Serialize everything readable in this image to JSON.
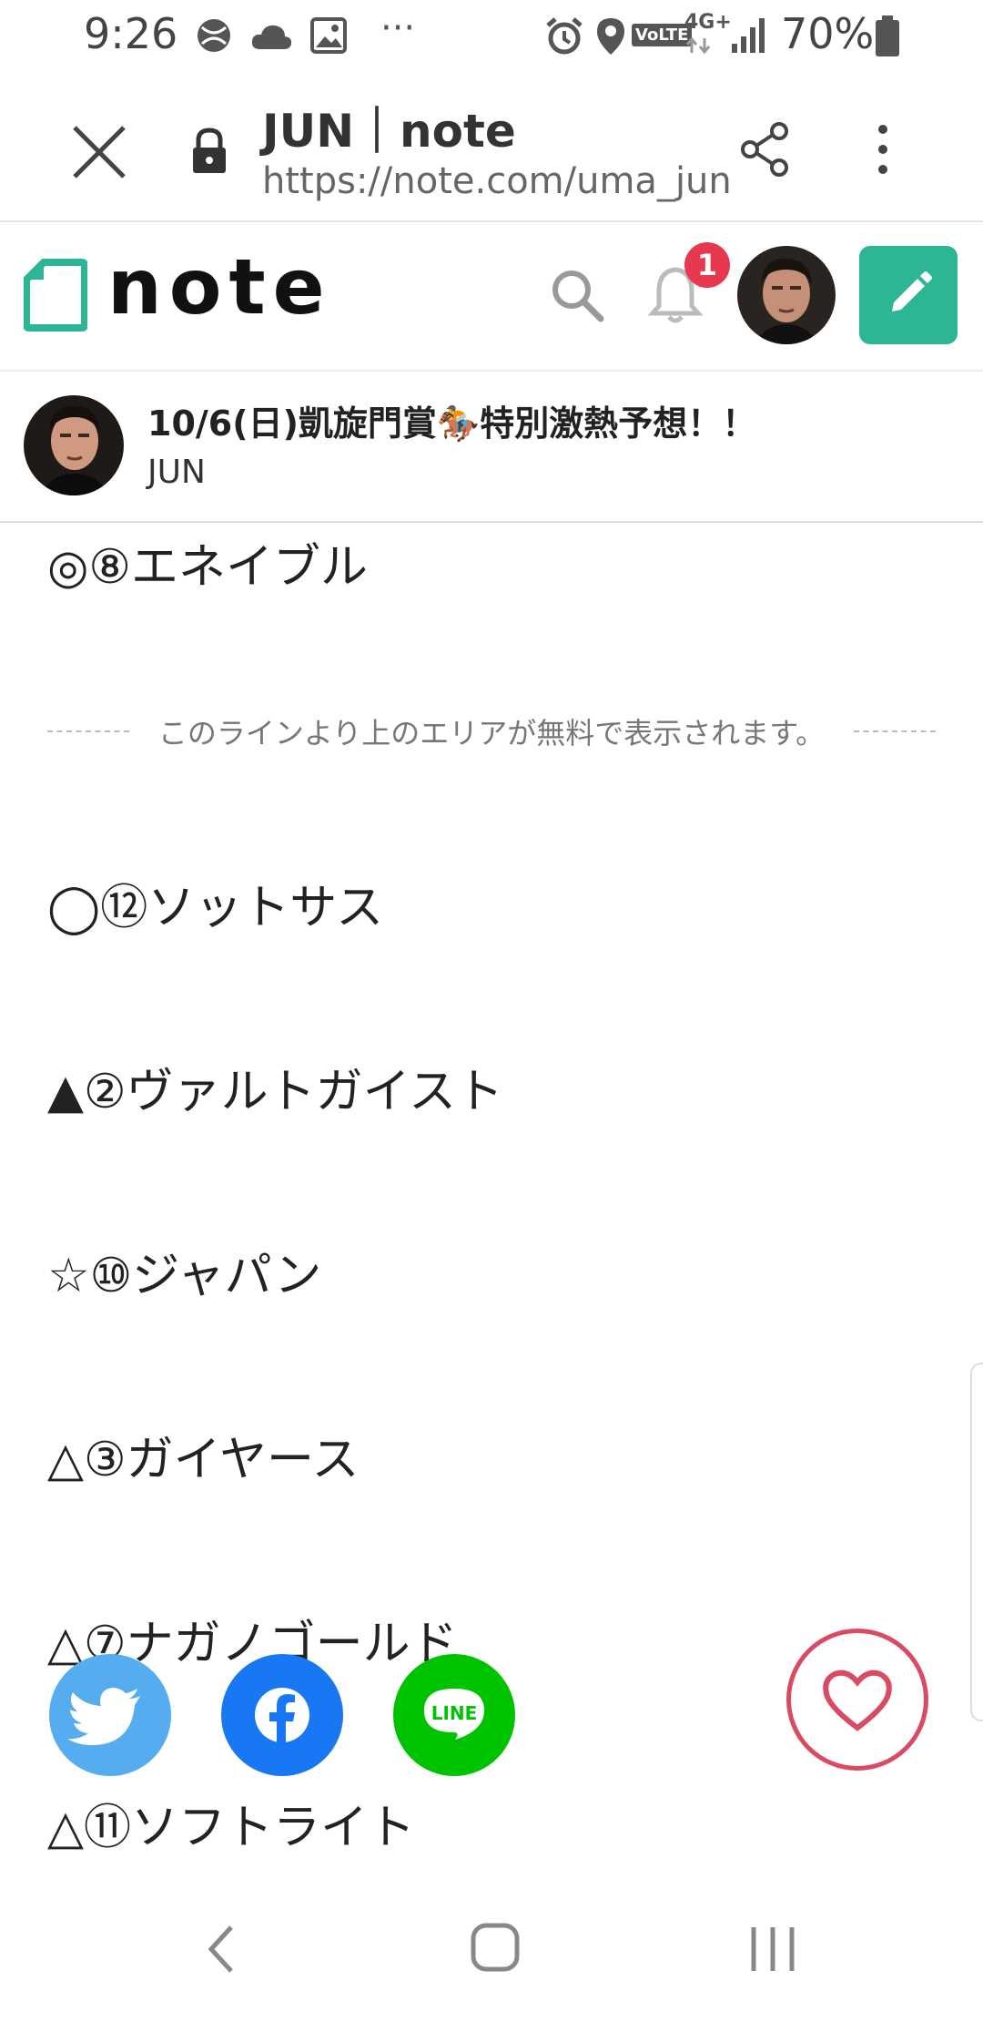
{
  "status_bar": {
    "time": "9:26",
    "more_dots": "···",
    "network": "4G+",
    "volte": "VoLTE",
    "battery": "70%"
  },
  "browser": {
    "title": "JUN｜note",
    "url": "https://note.com/uma_jun"
  },
  "note_header": {
    "logo_text": "note",
    "notification_count": "1",
    "accent": "#2cb696"
  },
  "article": {
    "title": "10/6(日)凱旋門賞🏇特別激熱予想！！",
    "author": "JUN",
    "top_pick": "◎⑧エネイブル",
    "free_line": "このラインより上のエリアが無料で表示されます。",
    "picks": [
      "◯⑫ソットサス",
      "▲②ヴァルトガイスト",
      "☆⑩ジャパン",
      "△③ガイヤース",
      "△⑦ナガノゴールド",
      "△⑪ソフトライト"
    ]
  },
  "share": {
    "line_label": "LINE"
  },
  "colors": {
    "twitter": "#55acee",
    "facebook": "#1877f2",
    "line": "#00c300",
    "like": "#d94a63",
    "badge": "#e8384f"
  }
}
